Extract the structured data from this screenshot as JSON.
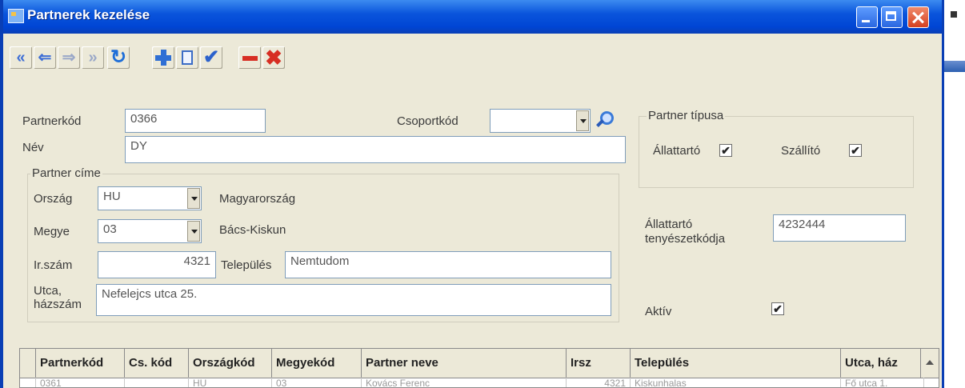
{
  "window": {
    "title": "Partnerek kezelése"
  },
  "colors": {
    "titlebar": "#0a55dc",
    "window_bg": "#ece9d8",
    "accent_blue": "#2f6fd4",
    "delete_red": "#d72e23"
  },
  "toolbar": {
    "icons": [
      "first-record-icon",
      "prev-record-icon",
      "next-record-icon",
      "last-record-icon",
      "refresh-icon",
      "add-icon",
      "edit-icon",
      "save-check-icon",
      "remove-icon",
      "delete-icon"
    ]
  },
  "form": {
    "partnerkod": {
      "label": "Partnerkód",
      "value": "0366"
    },
    "csoportkod": {
      "label": "Csoportkód",
      "value": ""
    },
    "nev": {
      "label": "Név",
      "value": "DY"
    },
    "partner_cime": {
      "legend": "Partner címe",
      "orszag": {
        "label": "Ország",
        "value": "HU",
        "name": "Magyarország"
      },
      "megye": {
        "label": "Megye",
        "value": "03",
        "name": "Bács-Kiskun"
      },
      "irszam": {
        "label": "Ir.szám",
        "value": "4321"
      },
      "telepules": {
        "label": "Település",
        "value": "Nemtudom"
      },
      "utca": {
        "label_line1": "Utca,",
        "label_line2": "házszám",
        "value": "Nefelejcs utca 25."
      }
    },
    "partner_tipusa": {
      "legend": "Partner típusa",
      "allattarto": {
        "label": "Állattartó",
        "checked": true
      },
      "szallito": {
        "label": "Szállító",
        "checked": true
      }
    },
    "tenyeszetkod": {
      "label_line1": "Állattartó",
      "label_line2": "tenyészetkódja",
      "value": "4232444"
    },
    "aktiv": {
      "label": "Aktív",
      "checked": true
    }
  },
  "grid": {
    "columns": [
      "Partnerkód",
      "Cs. kód",
      "Országkód",
      "Megyekód",
      "Partner neve",
      "Irsz",
      "Település",
      "Utca, ház"
    ],
    "rows": [
      [
        "0361",
        "",
        "HU",
        "03",
        "Kovács Ferenc",
        "4321",
        "Kiskunhalas",
        "Fő utca 1."
      ]
    ]
  }
}
